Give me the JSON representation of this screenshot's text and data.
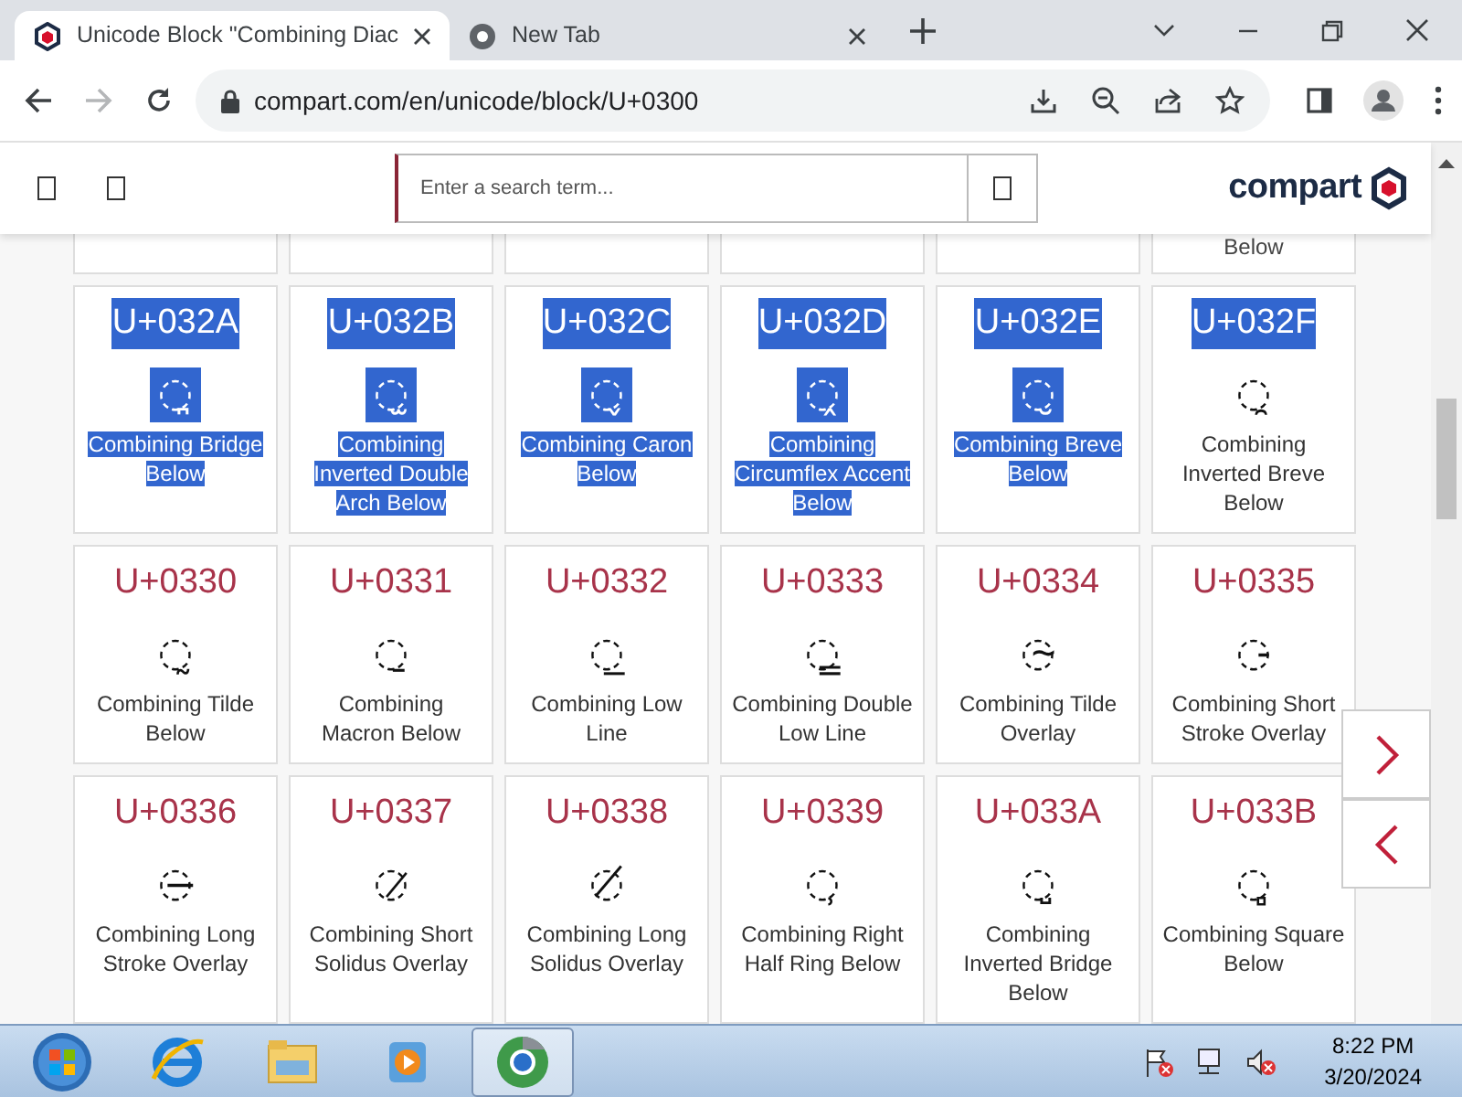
{
  "browser": {
    "tabs": [
      {
        "title": "Unicode Block \"Combining Diac",
        "selected": true
      },
      {
        "title": "New Tab",
        "selected": false
      }
    ],
    "url": "compart.com/en/unicode/block/U+0300"
  },
  "site_header": {
    "search": {
      "placeholder": "Enter a search term..."
    },
    "logo": "compart"
  },
  "partial_row": [
    {
      "kind": "blank"
    },
    {
      "kind": "blank"
    },
    {
      "kind": "blank"
    },
    {
      "kind": "blank"
    },
    {
      "kind": "blank"
    },
    {
      "kind": "text",
      "text": "Below"
    }
  ],
  "rows": [
    [
      {
        "code": "U+032A",
        "glyph": "◌̪",
        "name": "Combining Bridge Below",
        "code_selected": true,
        "name_selected": true
      },
      {
        "code": "U+032B",
        "glyph": "◌̫",
        "name": "Combining Inverted Double Arch Below",
        "code_selected": true,
        "name_selected": true
      },
      {
        "code": "U+032C",
        "glyph": "◌̬",
        "name": "Combining Caron Below",
        "code_selected": true,
        "name_selected": true
      },
      {
        "code": "U+032D",
        "glyph": "◌̭",
        "name": "Combining Circumflex Accent Below",
        "code_selected": true,
        "name_selected": true
      },
      {
        "code": "U+032E",
        "glyph": "◌̮",
        "name": "Combining Breve Below",
        "code_selected": true,
        "name_selected": true
      },
      {
        "code": "U+032F",
        "glyph": "◌̯",
        "name": "Combining Inverted Breve Below",
        "code_selected": true,
        "name_selected": false
      }
    ],
    [
      {
        "code": "U+0330",
        "glyph": "◌̰",
        "name": "Combining Tilde Below",
        "code_selected": false,
        "name_selected": false
      },
      {
        "code": "U+0331",
        "glyph": "◌̱",
        "name": "Combining Macron Below",
        "code_selected": false,
        "name_selected": false
      },
      {
        "code": "U+0332",
        "glyph": "◌̲",
        "name": "Combining Low Line",
        "code_selected": false,
        "name_selected": false
      },
      {
        "code": "U+0333",
        "glyph": "◌̳",
        "name": "Combining Double Low Line",
        "code_selected": false,
        "name_selected": false
      },
      {
        "code": "U+0334",
        "glyph": "◌̴",
        "name": "Combining Tilde Overlay",
        "code_selected": false,
        "name_selected": false
      },
      {
        "code": "U+0335",
        "glyph": "◌̵",
        "name": "Combining Short Stroke Overlay",
        "code_selected": false,
        "name_selected": false
      }
    ],
    [
      {
        "code": "U+0336",
        "glyph": "◌̶",
        "name": "Combining Long Stroke Overlay",
        "code_selected": false,
        "name_selected": false
      },
      {
        "code": "U+0337",
        "glyph": "◌̷",
        "name": "Combining Short Solidus Overlay",
        "code_selected": false,
        "name_selected": false
      },
      {
        "code": "U+0338",
        "glyph": "◌̸",
        "name": "Combining Long Solidus Overlay",
        "code_selected": false,
        "name_selected": false
      },
      {
        "code": "U+0339",
        "glyph": "◌̹",
        "name": "Combining Right Half Ring Below",
        "code_selected": false,
        "name_selected": false
      },
      {
        "code": "U+033A",
        "glyph": "◌̺",
        "name": "Combining Inverted Bridge Below",
        "code_selected": false,
        "name_selected": false
      },
      {
        "code": "U+033B",
        "glyph": "◌̻",
        "name": "Combining Square Below",
        "code_selected": false,
        "name_selected": false
      }
    ]
  ],
  "taskbar": {
    "time": "8:22 PM",
    "date": "3/20/2024"
  }
}
